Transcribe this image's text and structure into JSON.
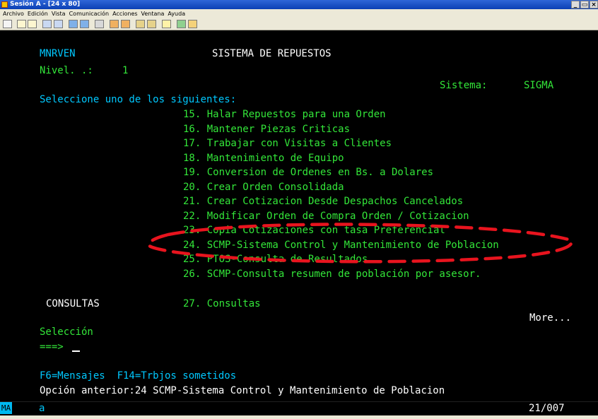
{
  "window": {
    "title": "Sesión A - [24 x 80]",
    "controls": [
      "_",
      "▭",
      "×"
    ]
  },
  "menu": [
    "Archivo",
    "Edición",
    "Vista",
    "Comunicación",
    "Acciones",
    "Ventana",
    "Ayuda"
  ],
  "screen": {
    "program": "MNRVEN",
    "heading": "SISTEMA DE REPUESTOS",
    "level_label": "Nivel. .:",
    "level_value": "1",
    "system_label": "Sistema:",
    "system_value": "SIGMA",
    "prompt": "Seleccione uno de los siguientes:",
    "options": [
      "15. Halar Repuestos para una Orden",
      "16. Mantener Piezas Criticas",
      "17. Trabajar con Visitas a Clientes",
      "18. Mantenimiento de Equipo",
      "19. Conversion de Ordenes en Bs. a Dolares",
      "20. Crear Orden Consolidada",
      "21. Crear Cotizacion Desde Despachos Cancelados",
      "22. Modificar Orden de Compra Orden / Cotizacion",
      "23. Copia Cotizaciones con tasa Preferencial",
      "24. SCMP-Sistema Control y Mantenimiento de Poblacion",
      "25. PTOS-Consulta de Resultados",
      "26. SCMP-Consulta resumen de población por asesor."
    ],
    "section_label": "CONSULTAS",
    "section_option": "27. Consultas",
    "more": "More...",
    "selection_label": "Selección",
    "input_prompt": "===>",
    "function_keys": "F6=Mensajes  F14=Trbjos sometidos",
    "previous_option": "Opción anterior:24 SCMP-Sistema Control y Mantenimiento de Poblacion"
  },
  "status": {
    "mode": "MA",
    "indicator": "a",
    "position": "21/007"
  },
  "colors": {
    "green": "#33e639",
    "white": "#ffffff",
    "cyan": "#00c8ff",
    "annotation": "#e8141e"
  }
}
